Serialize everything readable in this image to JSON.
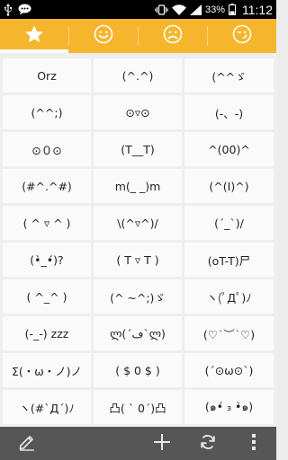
{
  "status_bar": {
    "battery": "33%",
    "time": "11:12",
    "icons": [
      "usb-icon",
      "chat-icon",
      "vibrate-icon",
      "wifi-icon",
      "signal-icon",
      "battery-icon"
    ]
  },
  "tabs": [
    {
      "name": "favorites",
      "icon": "star-icon",
      "active": true
    },
    {
      "name": "happy",
      "icon": "smile-face-icon",
      "active": false
    },
    {
      "name": "sad",
      "icon": "sad-face-icon",
      "active": false
    },
    {
      "name": "wink",
      "icon": "wink-face-icon",
      "active": false
    }
  ],
  "emoticons": [
    "Orz",
    "(^.^)",
    "(^^ゞ",
    "(^^;)",
    "⊙▿⊙",
    "(-、-)",
    "⊙０⊙",
    "(T__T)",
    "^(00)^",
    "(#^.^#)",
    "m(_ _)m",
    "(^(I)^)",
    "( ^ ▿ ^ )",
    "\\(^▿^)/",
    "(´_`)/",
    "(•̀_•́)?",
    "( T ▿ T )",
    "(oT-T)尸",
    "( ^_^ )",
    "(^ ~^;)ゞ",
    "ヽ(ﾟДﾟ)ﾉ",
    "(-_-) zzz",
    "ლ(´ڡ`ლ)",
    "(♡˙︶˙♡)",
    "Σ(・ω・ノ)ノ",
    "( $ 0 $ )",
    "(´⊙ω⊙`)",
    "ヽ(#`Д´)ﾉ",
    "凸( ` 0´)凸",
    "(๑•́ ₃ •̀๑)"
  ],
  "bottom_bar": {
    "icons": [
      "edit-icon",
      "add-icon",
      "refresh-icon",
      "overflow-menu-icon"
    ]
  },
  "colors": {
    "accent": "#f5b62e",
    "status_bar": "#000000",
    "bottom_bar": "#565656",
    "cell_bg": "#fafafa"
  }
}
